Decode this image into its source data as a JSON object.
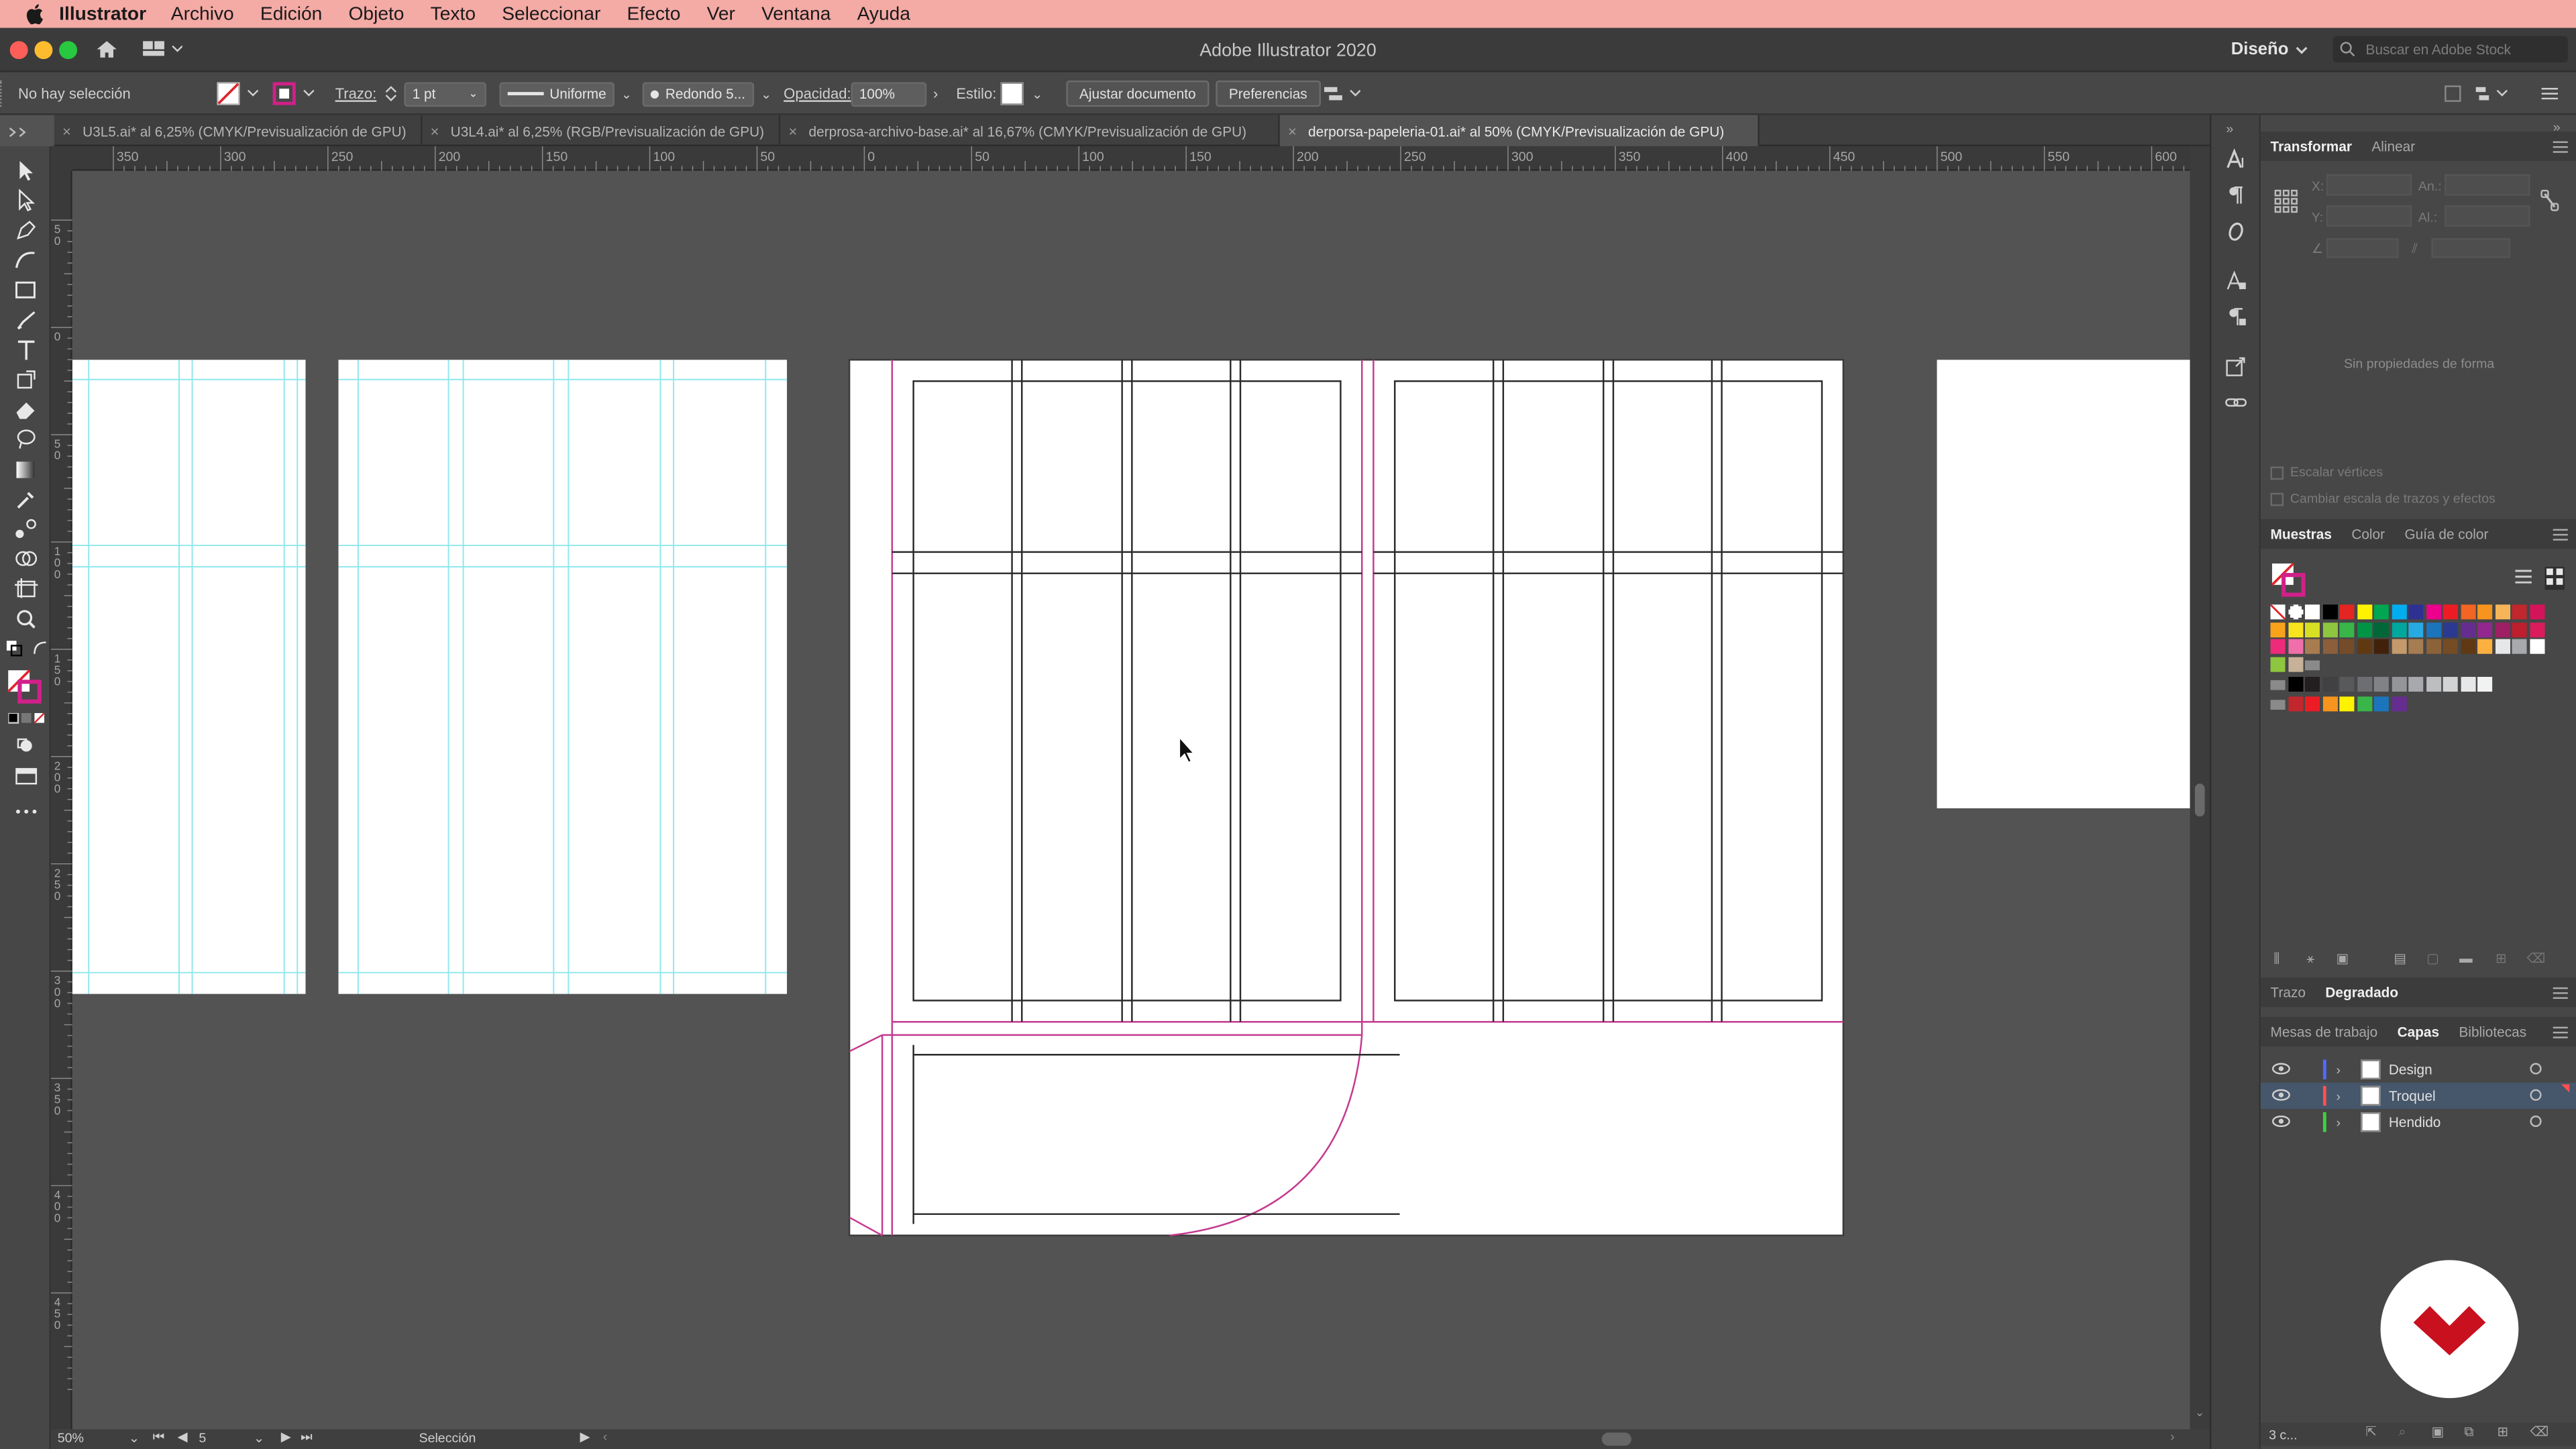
{
  "menubar": {
    "app": "Illustrator",
    "items": [
      "Archivo",
      "Edición",
      "Objeto",
      "Texto",
      "Seleccionar",
      "Efecto",
      "Ver",
      "Ventana",
      "Ayuda"
    ]
  },
  "titlebar": {
    "title": "Adobe Illustrator 2020",
    "workspace": "Diseño",
    "search_placeholder": "Buscar en Adobe Stock"
  },
  "controlbar": {
    "selection": "No hay selección",
    "stroke_label": "Trazo:",
    "stroke_value": "1 pt",
    "profile": "Uniforme",
    "brush": "Redondo 5...",
    "opacity_label": "Opacidad:",
    "opacity_value": "100%",
    "style_label": "Estilo:",
    "fit_button": "Ajustar documento",
    "prefs_button": "Preferencias"
  },
  "tabs": [
    "U3L5.ai* al 6,25% (CMYK/Previsualización de GPU)",
    "U3L4.ai* al 6,25% (RGB/Previsualización de GPU)",
    "derprosa-archivo-base.ai* al 16,67% (CMYK/Previsualización de GPU)",
    "derporsa-papeleria-01.ai* al 50% (CMYK/Previsualización de GPU)"
  ],
  "rulers": {
    "h_labels": [
      "350",
      "300",
      "250",
      "200",
      "150",
      "100",
      "50",
      "0",
      "50",
      "100",
      "150",
      "200",
      "250",
      "300",
      "350",
      "400",
      "450",
      "500",
      "550",
      "600"
    ],
    "v_labels": [
      "50",
      "0",
      "50",
      "100",
      "150",
      "200",
      "250",
      "300",
      "350",
      "400",
      "450"
    ]
  },
  "status": {
    "zoom": "50%",
    "artboard": "5",
    "tool": "Selección"
  },
  "transform_panel": {
    "tabs": [
      "Transformar",
      "Alinear"
    ],
    "x_label": "X:",
    "y_label": "Y:",
    "w_label": "An.:",
    "h_label": "Al.:",
    "no_props": "Sin propiedades de forma",
    "scale_corners": "Escalar vértices",
    "scale_strokes": "Cambiar escala de trazos y efectos"
  },
  "swatches_panel": {
    "tabs": [
      "Muestras",
      "Color",
      "Guía de color"
    ]
  },
  "gradient_panel": {
    "tabs": [
      "Trazo",
      "Degradado"
    ]
  },
  "layers_panel": {
    "tabs": [
      "Mesas de trabajo",
      "Capas",
      "Bibliotecas"
    ],
    "layers": [
      {
        "name": "Design",
        "color": "#4f6bff"
      },
      {
        "name": "Troquel",
        "color": "#ff4f4f"
      },
      {
        "name": "Hendido",
        "color": "#3ed13e"
      }
    ],
    "count": "3 c..."
  },
  "colors": {
    "menubar": "#f4aaa5",
    "guide": "#8ee8ee",
    "bleed": "#c5398f",
    "logo_red": "#c8101e"
  }
}
